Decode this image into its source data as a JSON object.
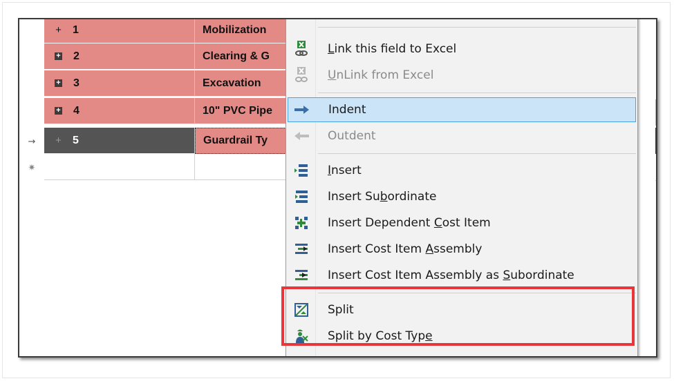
{
  "rows": [
    {
      "num": "1",
      "desc": "Mobilization",
      "expander": "+"
    },
    {
      "num": "2",
      "desc": "Clearing & G",
      "expander": "+"
    },
    {
      "num": "3",
      "desc": "Excavation",
      "expander": "+"
    },
    {
      "num": "4",
      "desc": "10\" PVC Pipe",
      "expander": "+"
    },
    {
      "num": "5",
      "desc": "Guardrail Ty",
      "expander": "+"
    }
  ],
  "indicators": {
    "current": "→",
    "new": "✷"
  },
  "menu": {
    "items": [
      {
        "pre": "",
        "u": "L",
        "post": "ink this field to Excel",
        "icon": "excel-link-icon",
        "state": "normal"
      },
      {
        "pre": "",
        "u": "U",
        "post": "nLink from Excel",
        "icon": "excel-unlink-icon",
        "state": "disabled"
      },
      {
        "pre": "Indent",
        "u": "",
        "post": "",
        "icon": "indent-arrow-icon",
        "state": "highlight"
      },
      {
        "pre": "Outdent",
        "u": "",
        "post": "",
        "icon": "outdent-arrow-icon",
        "state": "disabled"
      },
      {
        "pre": "",
        "u": "I",
        "post": "nsert",
        "icon": "insert-row-icon",
        "state": "normal"
      },
      {
        "pre": "Insert Su",
        "u": "b",
        "post": "ordinate",
        "icon": "insert-subordinate-icon",
        "state": "normal"
      },
      {
        "pre": "Insert Dependent ",
        "u": "C",
        "post": "ost Item",
        "icon": "insert-dependent-icon",
        "state": "normal"
      },
      {
        "pre": "Insert Cost Item ",
        "u": "A",
        "post": "ssembly",
        "icon": "insert-assembly-icon",
        "state": "normal"
      },
      {
        "pre": "Insert Cost Item Assembly as ",
        "u": "S",
        "post": "ubordinate",
        "icon": "insert-assembly-subordinate-icon",
        "state": "normal"
      },
      {
        "pre": "Split",
        "u": "",
        "post": "",
        "icon": "split-icon",
        "state": "normal"
      },
      {
        "pre": "Split by Cost Typ",
        "u": "e",
        "post": "",
        "icon": "split-cost-type-icon",
        "state": "normal"
      }
    ]
  },
  "colors": {
    "row_red": "#e48a86",
    "row_dark": "#545454",
    "highlight": "#cce4f7",
    "annotation_box": "#e8373a"
  }
}
